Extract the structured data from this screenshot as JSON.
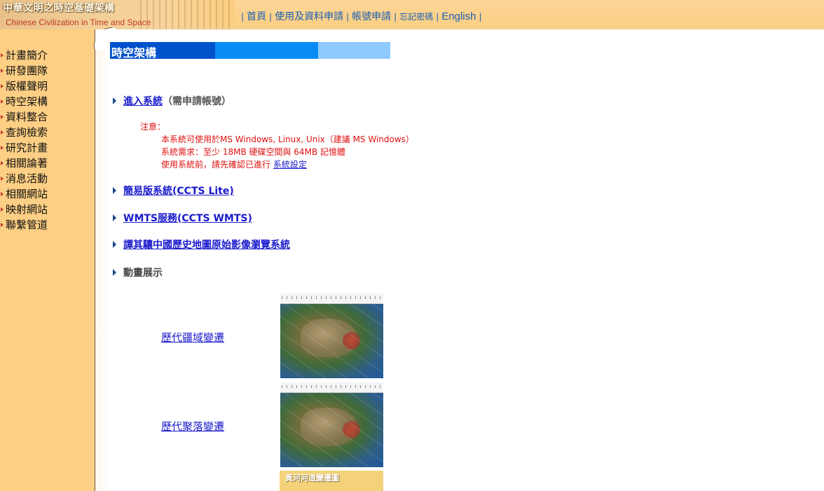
{
  "header": {
    "logo_zh": "中華文明之時空基礎架構",
    "logo_en": "Chinese Civilization in Time and Space",
    "nav": [
      {
        "label": "首頁"
      },
      {
        "label": "使用及資料申請"
      },
      {
        "label": "帳號申請"
      },
      {
        "label": "忘記密碼"
      },
      {
        "label": "English"
      }
    ],
    "separator": "|"
  },
  "sidebar": {
    "items": [
      {
        "label": "計畫簡介"
      },
      {
        "label": "研發團隊"
      },
      {
        "label": "版權聲明"
      },
      {
        "label": "時空架構"
      },
      {
        "label": "資料整合"
      },
      {
        "label": "查詢檢索"
      },
      {
        "label": "研究計畫"
      },
      {
        "label": "相關論著"
      },
      {
        "label": "消息活動"
      },
      {
        "label": "相關網站"
      },
      {
        "label": "映射網站"
      },
      {
        "label": "聯繫管道"
      }
    ]
  },
  "main": {
    "title": "時空架構",
    "enter_system": {
      "label": "進入系統",
      "note": "（需申請帳號）"
    },
    "notice": {
      "heading": "注意：",
      "line1": "本系統可使用於MS Windows, Linux, Unix（建議 MS Windows）",
      "line2": "系統需求：至少 18MB 硬碟空間與 64MB 記憶體",
      "line3_prefix": "使用系統前，請先確認已進行 ",
      "line3_link": "系統設定"
    },
    "lite": "簡易版系統(CCTS Lite)",
    "wmts": "WMTS服務(CCTS WMTS)",
    "tan": "譚其驤中國歷史地圖原始影像瀏覽系統",
    "animation": "動畫展示",
    "animations": [
      {
        "label": "歷代疆域變遷"
      },
      {
        "label": "歷代聚落變遷"
      }
    ],
    "yellow_thumb_text": "黃河河道變遷圖"
  }
}
